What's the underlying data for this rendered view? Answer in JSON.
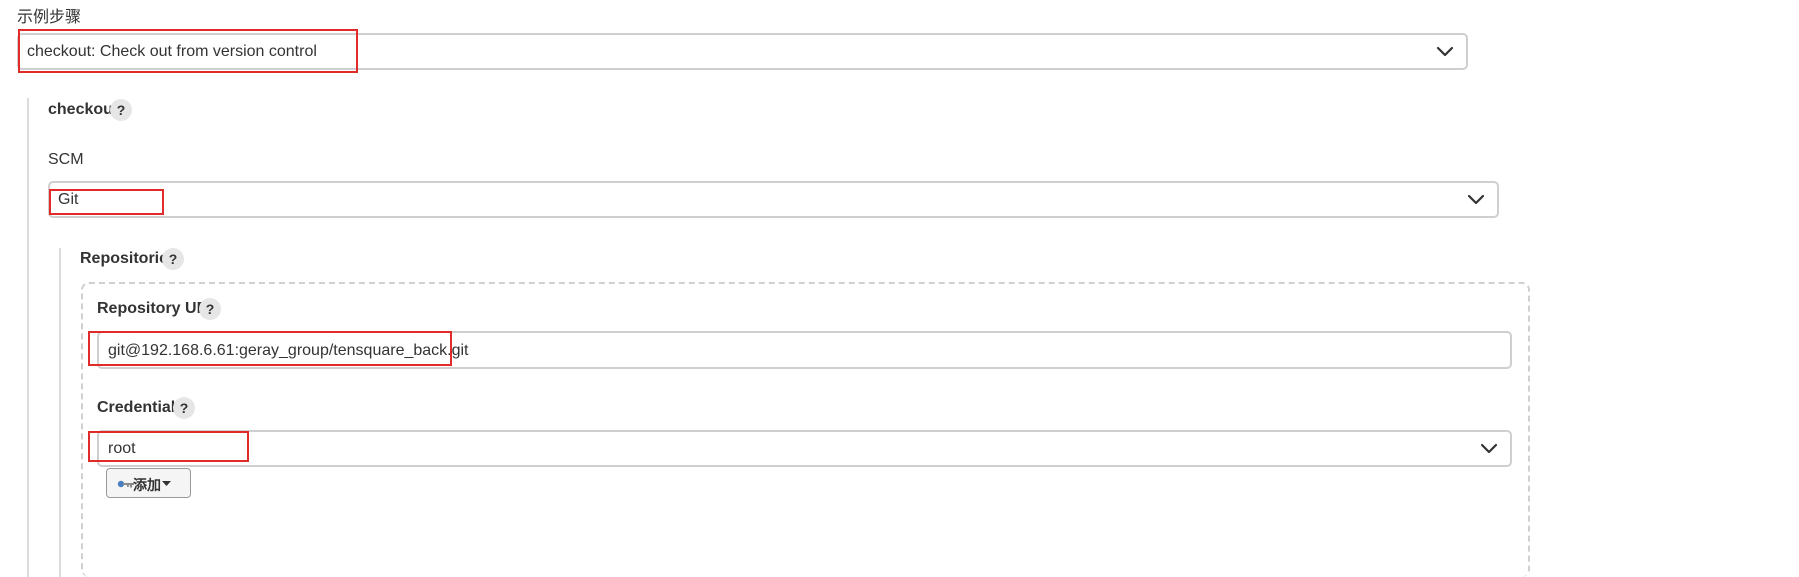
{
  "sample_step": {
    "heading": "示例步骤",
    "selected": "checkout: Check out from version control"
  },
  "checkout": {
    "label": "checkout",
    "help": "?"
  },
  "scm": {
    "label": "SCM",
    "selected": "Git"
  },
  "repositories": {
    "label": "Repositories",
    "help": "?",
    "repository_url": {
      "label": "Repository URL",
      "help": "?",
      "value": "git@192.168.6.61:geray_group/tensquare_back.git"
    },
    "credentials": {
      "label": "Credentials",
      "help": "?",
      "selected": "root",
      "add_button": "添加"
    }
  },
  "colors": {
    "highlight": "#e02b2b",
    "border": "#cfcfcf"
  },
  "icons": {
    "dropdown": "chevron-down-icon",
    "key": "key-icon",
    "caret": "caret-down-icon",
    "help": "help-icon"
  }
}
